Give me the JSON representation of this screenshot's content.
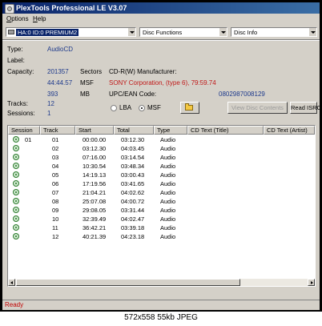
{
  "window": {
    "title": "PlexTools Professional LE V3.07"
  },
  "menu": {
    "options": "Options",
    "help": "Help"
  },
  "toolbar": {
    "drive": "HA:0 ID:0  PREMIUM2",
    "disc_functions": "Disc Functions",
    "disc_info": "Disc Info"
  },
  "info": {
    "type_label": "Type:",
    "type_value": "AudioCD",
    "label_label": "Label:",
    "capacity_label": "Capacity:",
    "sectors_value": "201357",
    "sectors_unit": "Sectors",
    "msf_value": "44:44.57",
    "msf_unit": "MSF",
    "mb_value": "393",
    "mb_unit": "MB",
    "cdr_label": "CD-R(W) Manufacturer:",
    "cdr_value": "SONY Corporation, (type 6), 79:59.74",
    "upc_label": "UPC/EAN Code:",
    "upc_value": "0802987008129",
    "tracks_label": "Tracks:",
    "tracks_value": "12",
    "sessions_label": "Sessions:",
    "sessions_value": "1",
    "radio_lba": "LBA",
    "radio_msf": "MSF",
    "selected_mode": "MSF",
    "view_contents": "View Disc Contents",
    "read_isrc": "Read ISRC"
  },
  "table": {
    "columns": [
      "Session",
      "Track",
      "Start",
      "Total",
      "Type",
      "CD Text (Title)",
      "CD Text (Artist)"
    ],
    "rows": [
      {
        "session": "01",
        "track": "01",
        "start": "00:00.00",
        "total": "03:12.30",
        "type": "Audio"
      },
      {
        "session": "",
        "track": "02",
        "start": "03:12.30",
        "total": "04:03.45",
        "type": "Audio"
      },
      {
        "session": "",
        "track": "03",
        "start": "07:16.00",
        "total": "03:14.54",
        "type": "Audio"
      },
      {
        "session": "",
        "track": "04",
        "start": "10:30.54",
        "total": "03:48.34",
        "type": "Audio"
      },
      {
        "session": "",
        "track": "05",
        "start": "14:19.13",
        "total": "03:00.43",
        "type": "Audio"
      },
      {
        "session": "",
        "track": "06",
        "start": "17:19.56",
        "total": "03:41.65",
        "type": "Audio"
      },
      {
        "session": "",
        "track": "07",
        "start": "21:04.21",
        "total": "04:02.62",
        "type": "Audio"
      },
      {
        "session": "",
        "track": "08",
        "start": "25:07.08",
        "total": "04:00.72",
        "type": "Audio"
      },
      {
        "session": "",
        "track": "09",
        "start": "29:08.05",
        "total": "03:31.44",
        "type": "Audio"
      },
      {
        "session": "",
        "track": "10",
        "start": "32:39.49",
        "total": "04:02.47",
        "type": "Audio"
      },
      {
        "session": "",
        "track": "11",
        "start": "36:42.21",
        "total": "03:39.18",
        "type": "Audio"
      },
      {
        "session": "",
        "track": "12",
        "start": "40:21.39",
        "total": "04:23.18",
        "type": "Audio"
      }
    ]
  },
  "status": {
    "text": "Ready"
  },
  "caption": "572x558 55kb JPEG"
}
